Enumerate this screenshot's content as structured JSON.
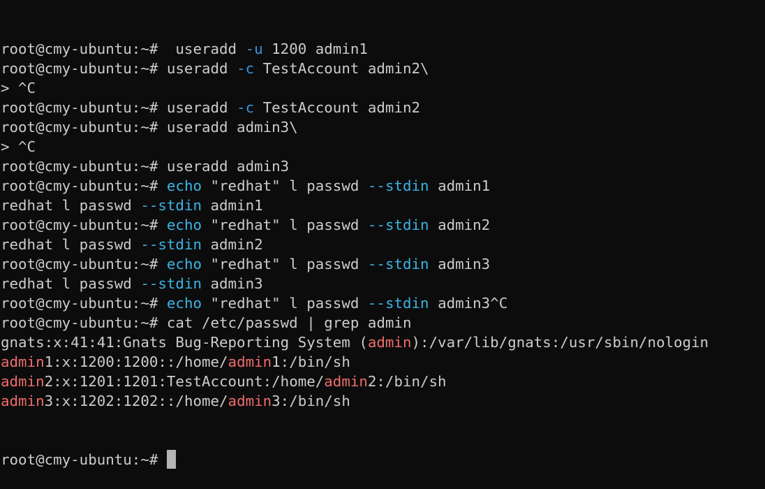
{
  "terminal": {
    "background": "#0c0c0c",
    "foreground": "#cccccc",
    "colors": {
      "option": "#3a96dd",
      "keyword": "#3ab4e6",
      "match": "#f06c6c"
    },
    "lines": [
      [
        {
          "t": "root@cmy-ubuntu:~#  useradd "
        },
        {
          "t": "-u",
          "c": "blue"
        },
        {
          "t": " 1200 admin1"
        }
      ],
      [
        {
          "t": "root@cmy-ubuntu:~# useradd "
        },
        {
          "t": "-c",
          "c": "blue"
        },
        {
          "t": " TestAccount admin2\\"
        }
      ],
      [
        {
          "t": "> ^C"
        }
      ],
      [
        {
          "t": "root@cmy-ubuntu:~# useradd "
        },
        {
          "t": "-c",
          "c": "blue"
        },
        {
          "t": " TestAccount admin2"
        }
      ],
      [
        {
          "t": "root@cmy-ubuntu:~# useradd admin3\\"
        }
      ],
      [
        {
          "t": "> ^C"
        }
      ],
      [
        {
          "t": "root@cmy-ubuntu:~# useradd admin3"
        }
      ],
      [
        {
          "t": "root@cmy-ubuntu:~# "
        },
        {
          "t": "echo",
          "c": "cyan"
        },
        {
          "t": " \"redhat\" l passwd "
        },
        {
          "t": "--stdin",
          "c": "cyan"
        },
        {
          "t": " admin1"
        }
      ],
      [
        {
          "t": "redhat l passwd "
        },
        {
          "t": "--stdin",
          "c": "cyan"
        },
        {
          "t": " admin1"
        }
      ],
      [
        {
          "t": "root@cmy-ubuntu:~# "
        },
        {
          "t": "echo",
          "c": "cyan"
        },
        {
          "t": " \"redhat\" l passwd "
        },
        {
          "t": "--stdin",
          "c": "cyan"
        },
        {
          "t": " admin2"
        }
      ],
      [
        {
          "t": "redhat l passwd "
        },
        {
          "t": "--stdin",
          "c": "cyan"
        },
        {
          "t": " admin2"
        }
      ],
      [
        {
          "t": "root@cmy-ubuntu:~# "
        },
        {
          "t": "echo",
          "c": "cyan"
        },
        {
          "t": " \"redhat\" l passwd "
        },
        {
          "t": "--stdin",
          "c": "cyan"
        },
        {
          "t": " admin3"
        }
      ],
      [
        {
          "t": "redhat l passwd "
        },
        {
          "t": "--stdin",
          "c": "cyan"
        },
        {
          "t": " admin3"
        }
      ],
      [
        {
          "t": "root@cmy-ubuntu:~# "
        },
        {
          "t": "echo",
          "c": "cyan"
        },
        {
          "t": " \"redhat\" l passwd "
        },
        {
          "t": "--stdin",
          "c": "cyan"
        },
        {
          "t": " admin3^C"
        }
      ],
      [
        {
          "t": "root@cmy-ubuntu:~# cat /etc/passwd | grep admin"
        }
      ],
      [
        {
          "t": "gnats:x:41:41:Gnats Bug-Reporting System ("
        },
        {
          "t": "admin",
          "c": "red"
        },
        {
          "t": "):/var/lib/gnats:/usr/sbin/nologin"
        }
      ],
      [
        {
          "t": "admin",
          "c": "red"
        },
        {
          "t": "1:x:1200:1200::/home/"
        },
        {
          "t": "admin",
          "c": "red"
        },
        {
          "t": "1:/bin/sh"
        }
      ],
      [
        {
          "t": "admin",
          "c": "red"
        },
        {
          "t": "2:x:1201:1201:TestAccount:/home/"
        },
        {
          "t": "admin",
          "c": "red"
        },
        {
          "t": "2:/bin/sh"
        }
      ],
      [
        {
          "t": "admin",
          "c": "red"
        },
        {
          "t": "3:x:1202:1202::/home/"
        },
        {
          "t": "admin",
          "c": "red"
        },
        {
          "t": "3:/bin/sh"
        }
      ]
    ],
    "prompt": "root@cmy-ubuntu:~# "
  }
}
